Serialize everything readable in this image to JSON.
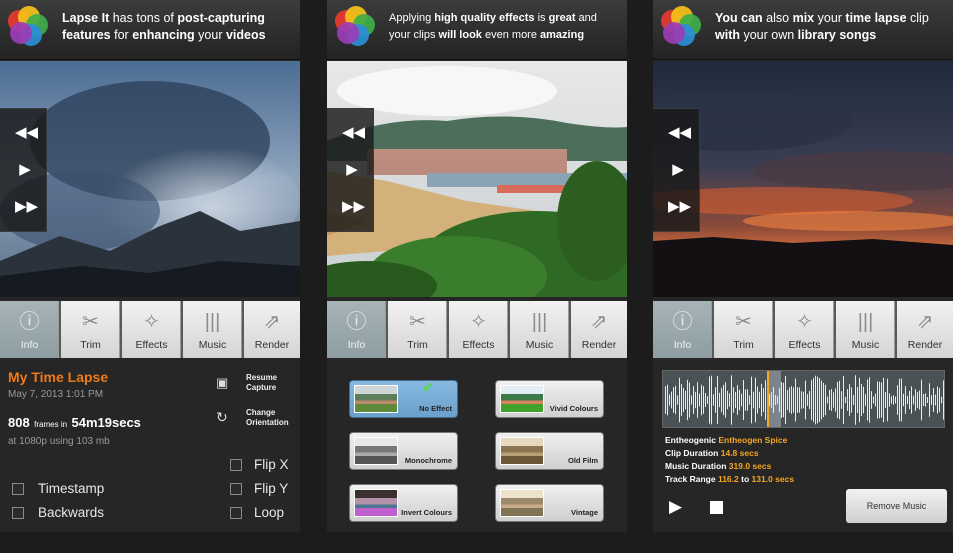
{
  "panels": [
    {
      "header": {
        "pre": "Lapse It",
        "mid1": " has tons of ",
        "b1": "post-capturing features",
        "mid2": " for ",
        "b2": "enhancing",
        "mid3": " your ",
        "b3": "videos"
      },
      "tabs": [
        "Info",
        "Trim",
        "Effects",
        "Music",
        "Render"
      ],
      "active_tab": "Info"
    },
    {
      "header": {
        "pre": "Applying ",
        "b1": "high quality effects",
        "mid1": " is ",
        "b2": "great",
        "mid2": " and your clips ",
        "b3": "will look",
        "mid3": " even more ",
        "b4": "amazing"
      },
      "tabs": [
        "Info",
        "Trim",
        "Effects",
        "Music",
        "Render"
      ],
      "active_tab": "Info"
    },
    {
      "header": {
        "b1": "You can",
        "mid1": " also ",
        "b2": "mix",
        "mid2": " your ",
        "b3": "time lapse",
        "mid3": " clip ",
        "b4": "with",
        "mid4": " your own ",
        "b5": "library songs"
      },
      "tabs": [
        "Info",
        "Trim",
        "Effects",
        "Music",
        "Render"
      ],
      "active_tab": "Info"
    }
  ],
  "info": {
    "title": "My Time Lapse",
    "date": "May 7, 2013 1:01 PM",
    "frames": "808",
    "frames_in": "frames in",
    "duration": "54m19secs",
    "quality": "at 1080p using 103 mb",
    "resume_label": "Resume Capture",
    "resume_line1": "Resume",
    "resume_line2": "Capture",
    "orient_line1": "Change",
    "orient_line2": "Orientation",
    "options": {
      "flip_x": "Flip X",
      "flip_y": "Flip Y",
      "loop": "Loop",
      "timestamp": "Timestamp",
      "backwards": "Backwards"
    }
  },
  "effects": [
    {
      "label": "No Effect",
      "selected": true
    },
    {
      "label": "Vivid Colours",
      "selected": false
    },
    {
      "label": "Monochrome",
      "selected": false
    },
    {
      "label": "Old Film",
      "selected": false
    },
    {
      "label": "Invert Colours",
      "selected": false
    },
    {
      "label": "Vintage",
      "selected": false
    }
  ],
  "music": {
    "artist": "Entheogenic",
    "song": "Entheogen Spice",
    "clip_duration_label": "Clip Duration",
    "clip_duration": "14.8 secs",
    "music_duration_label": "Music Duration",
    "music_duration": "319.0 secs",
    "track_range_label": "Track Range",
    "range_from": "116.2",
    "range_to": "to",
    "range_end": "131.0 secs",
    "remove_button": "Remove Music"
  },
  "icons": {
    "rewind": "rewind-icon",
    "play": "play-icon",
    "forward": "fast-forward-icon",
    "stop": "stop-icon"
  },
  "colors": {
    "accent": "#f07a17",
    "music_value": "#f5a623",
    "selected_effect": "#7aaed8",
    "waveform_highlight": "#f5a623"
  }
}
